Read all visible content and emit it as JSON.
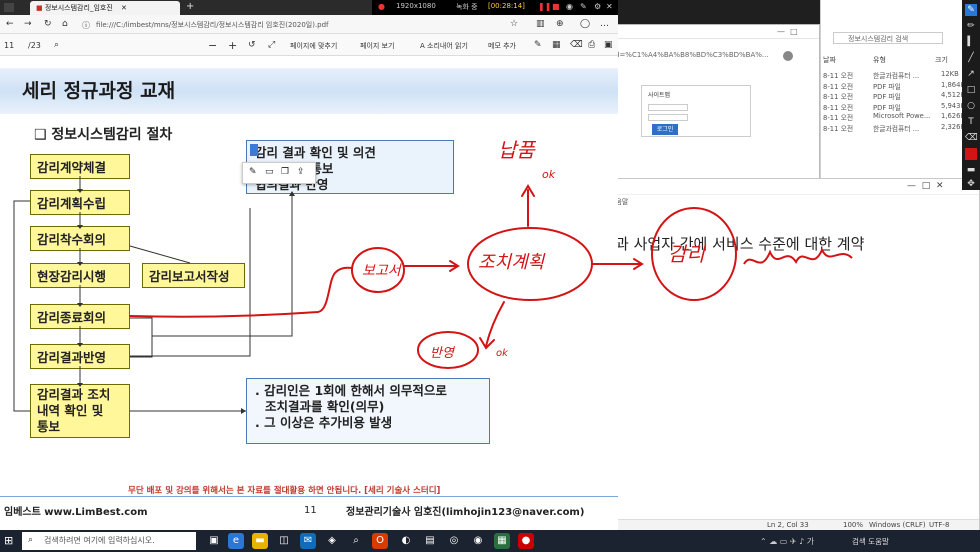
{
  "recording_bar": {
    "resolution": "1920x1080",
    "status": "녹화 중",
    "timer": "[00:28:14]"
  },
  "browser": {
    "tabs": [
      {
        "label": "정보시스템감리_임호진"
      }
    ],
    "address": "file:///C:/limbest/mns/정보시스템감리/정보시스템감리 임호진(2020일).pdf",
    "page_current": "11",
    "page_total": "/23",
    "pdf_tools": [
      "페이지에 맞추기",
      "페이지 보기",
      "A 소리내어 읽기",
      "메모 추가",
      "그리기",
      "강조 표시",
      "지우기"
    ]
  },
  "slide": {
    "title": "세리 정규과정 교재",
    "section": "❑ 정보시스템감리 절차",
    "flow": [
      "감리계약체결",
      "감리계획수립",
      "감리착수회의",
      "현장감리시행",
      "감리종료회의",
      "감리결과반영",
      "감리결과 조치\n내역 확인 및\n통보"
    ],
    "side_box": "감리보고서작성",
    "note_top": [
      "감리 결과 확인 및 의견",
      "고서 통보",
      "협의결과 반영"
    ],
    "note_bottom": [
      "감리인은 1회에 한해서 의무적으로",
      "조치결과를 확인(의무)",
      "그 이상은 추가비용 발생"
    ],
    "notice": "무단 배포 및 강의를 위해서는 본 자료를 절대활용 하면 안됩니다. [세리 기술사 스터디]",
    "footer_left": "임베스트 www.LimBest.com",
    "footer_page": "11",
    "footer_right": "정보관리기술사 임호진(limhojin123@naver.com)"
  },
  "handwriting": {
    "labels": [
      "납품",
      "ok",
      "보고서",
      "조치계획",
      "감리",
      "반영",
      "ok"
    ]
  },
  "notepad": {
    "text": "과 사업자 간에 서비스 수준에 대한 계약",
    "status": [
      "Ln 2, Col 33",
      "100%",
      "Windows (CRLF)",
      "UTF-8"
    ]
  },
  "back_window": {
    "url": "d=%C1%A4%BA%B8%BD%C3%BD%BA%...",
    "button": "로그인",
    "menu": "정보시스템감리 검색"
  },
  "explorer": {
    "search": "정보시스템감리 검색",
    "headers": [
      "날짜",
      "유형",
      "크기"
    ],
    "rows": [
      [
        "8-11 오전",
        "한글과컴퓨터 ...",
        "12KB"
      ],
      [
        "8-11 오전",
        "PDF 파일",
        "1,864KB"
      ],
      [
        "8-11 오전",
        "PDF 파일",
        "4,512KB"
      ],
      [
        "8-11 오전",
        "PDF 파일",
        "5,943KB"
      ],
      [
        "8-11 오전",
        "Microsoft Powe...",
        "1,626KB"
      ],
      [
        "8-11 오전",
        "한글과컴퓨터 ...",
        "2,326KB"
      ]
    ]
  },
  "taskbar": {
    "search_placeholder": "검색하려면 여기에 입력하십시오.",
    "tray_text": "검색 도움말"
  },
  "colors": {
    "accent": "#2b77d6",
    "slide_box": "#fff79a",
    "ink": "#d41414"
  }
}
